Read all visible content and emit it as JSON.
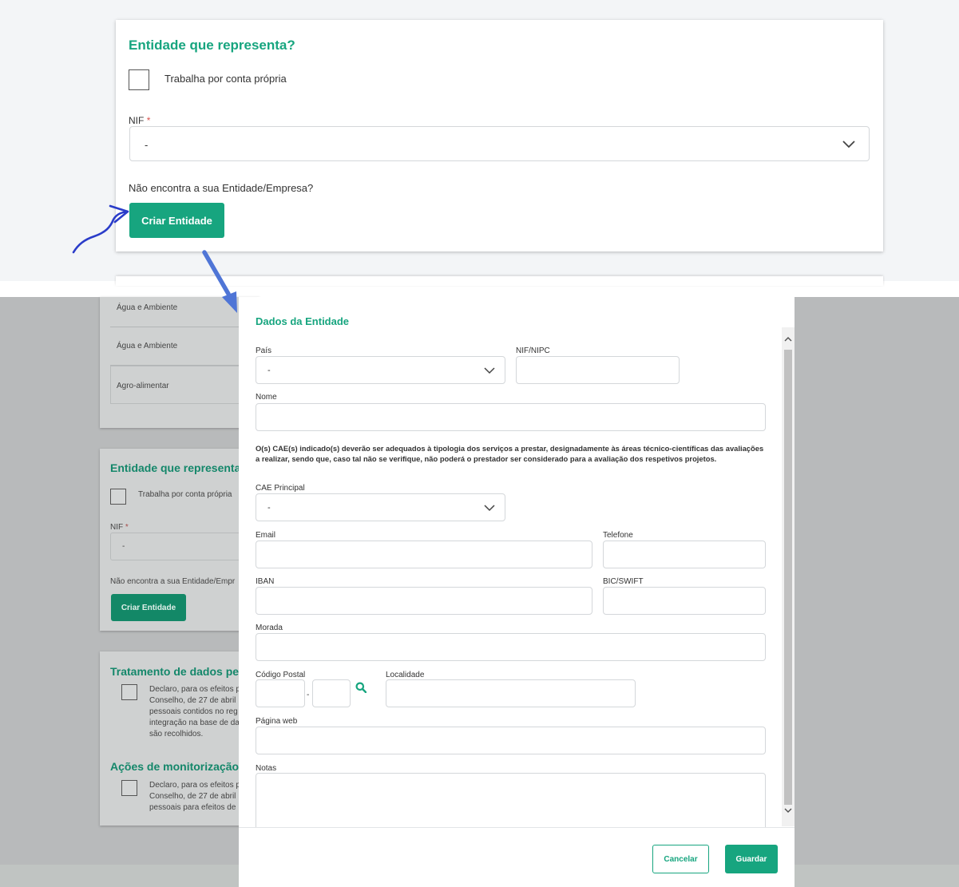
{
  "top_card": {
    "title": "Entidade que representa?",
    "self_employed_label": "Trabalha por conta própria",
    "nif_label": "NIF",
    "required_mark": "*",
    "nif_value": "-",
    "help_text": "Não encontra a sua Entidade/Empresa?",
    "create_button": "Criar Entidade"
  },
  "background_page": {
    "areas": [
      "Água e Ambiente",
      "Água e Ambiente",
      "Agro-alimentar"
    ],
    "entity_title": "Entidade que representa?",
    "self_employed_label": "Trabalha por conta própria",
    "nif_label": "NIF",
    "required_mark": "*",
    "nif_value": "-",
    "help_text": "Não encontra a sua Entidade/Empr",
    "create_button": "Criar Entidade",
    "data_treatment_title": "Tratamento de dados pes",
    "data_treatment_lines": [
      "Declaro, para os efeitos p",
      "Conselho, de 27 de abril",
      "pessoais contidos no reg",
      "integração na base de da",
      "são recolhidos."
    ],
    "monitoring_title": "Ações de monitorização e",
    "monitoring_lines": [
      "Declaro, para os efeitos p",
      "Conselho, de 27 de abril",
      "pessoais para efeitos de"
    ]
  },
  "modal": {
    "title": "Dados da Entidade",
    "country_label": "País",
    "country_value": "-",
    "nif_nipc_label": "NIF/NIPC",
    "name_label": "Nome",
    "notice": "O(s) CAE(s) indicado(s) deverão ser adequados à tipologia dos serviços a prestar, designadamente às áreas técnico-científicas das avaliações a realizar, sendo que, caso tal não se verifique, não poderá o prestador ser considerado para a avaliação dos respetivos projetos.",
    "cae_label": "CAE Principal",
    "cae_value": "-",
    "email_label": "Email",
    "phone_label": "Telefone",
    "iban_label": "IBAN",
    "bic_label": "BIC/SWIFT",
    "address_label": "Morada",
    "postal_label": "Código Postal",
    "postal_dash": "-",
    "locality_label": "Localidade",
    "website_label": "Página web",
    "notes_label": "Notas",
    "cancel_button": "Cancelar",
    "save_button": "Guardar"
  },
  "colors": {
    "brand_green": "#17a57f",
    "annotation_blue": "#3a5fcd"
  }
}
